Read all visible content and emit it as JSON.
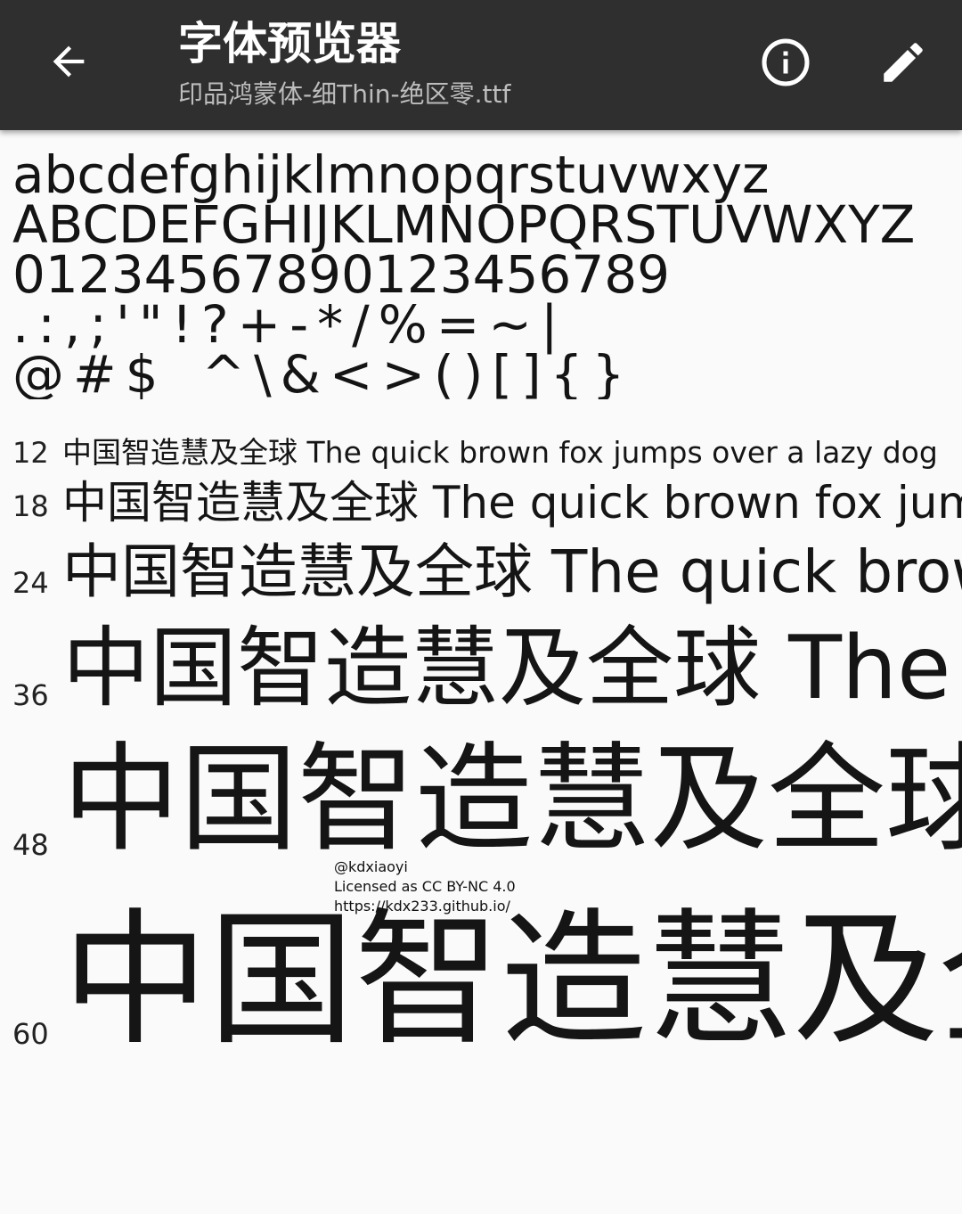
{
  "appbar": {
    "title": "字体预览器",
    "subtitle": "印品鸿蒙体-细Thin-绝区零.ttf",
    "back_icon": "arrow-left-icon",
    "info_icon": "info-circle-icon",
    "edit_icon": "pencil-icon",
    "background": "#2f2f2f"
  },
  "charset": {
    "lowercase": "abcdefghijklmnopqrstuvwxyz",
    "uppercase": "ABCDEFGHIJKLMNOPQRSTUVWXYZ",
    "digits": "01234567890123456789",
    "punct1": ".:,;'\"!?+-*/%=~|",
    "punct2": "@#$_^\\&<>()[]{}"
  },
  "samples": [
    {
      "size": "12",
      "text": "中国智造慧及全球  The quick brown fox jumps over a lazy dog"
    },
    {
      "size": "18",
      "text": "中国智造慧及全球  The quick brown fox jumps over a lazy dog"
    },
    {
      "size": "24",
      "text": "中国智造慧及全球  The quick brown fox jumps over a lazy dog"
    },
    {
      "size": "36",
      "text": "中国智造慧及全球  The quick brown fox"
    },
    {
      "size": "48",
      "text": "中国智造慧及全球"
    },
    {
      "size": "60",
      "text": "中国智造慧及全球"
    }
  ],
  "watermark": {
    "line1": "@kdxiaoyi",
    "line2": "Licensed as CC BY-NC 4.0",
    "line3": "https://kdx233.github.io/"
  }
}
